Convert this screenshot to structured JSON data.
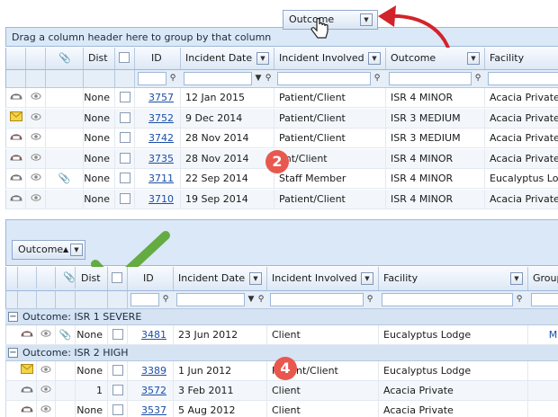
{
  "top": {
    "group_hint": "Drag a column header here to group by that column",
    "dragged_chip": "Outcome",
    "columns": [
      "Dist",
      "ID",
      "Incident Date",
      "Incident Involved",
      "Outcome",
      "Facility"
    ],
    "rows": [
      {
        "icon": "lock-grey",
        "dist": "None",
        "id": "3757",
        "date": "12 Jan 2015",
        "involved": "Patient/Client",
        "outcome": "ISR 4 MINOR",
        "facility": "Acacia Private",
        "attach": false
      },
      {
        "icon": "envelope",
        "dist": "None",
        "id": "3752",
        "date": "9 Dec 2014",
        "involved": "Patient/Client",
        "outcome": "ISR 3 MEDIUM",
        "facility": "Acacia Private",
        "attach": false
      },
      {
        "icon": "lock-red",
        "dist": "None",
        "id": "3742",
        "date": "28 Nov 2014",
        "involved": "Patient/Client",
        "outcome": "ISR 3 MEDIUM",
        "facility": "Acacia Private",
        "attach": false
      },
      {
        "icon": "lock-red",
        "dist": "None",
        "id": "3735",
        "date": "28 Nov 2014",
        "involved": "ent/Client",
        "outcome": "ISR 4 MINOR",
        "facility": "Acacia Private",
        "attach": false
      },
      {
        "icon": "lock-grey",
        "dist": "None",
        "id": "3711",
        "date": "22 Sep 2014",
        "involved": "Staff Member",
        "outcome": "ISR 4 MINOR",
        "facility": "Eucalyptus Lodge",
        "attach": true
      },
      {
        "icon": "lock-grey",
        "dist": "None",
        "id": "3710",
        "date": "19 Sep 2014",
        "involved": "Patient/Client",
        "outcome": "ISR 4 MINOR",
        "facility": "Acacia Private",
        "attach": false
      }
    ],
    "badge": "2"
  },
  "bottom": {
    "group_chip": "Outcome",
    "columns": [
      "Dist",
      "ID",
      "Incident Date",
      "Incident Involved",
      "Facility",
      "Group"
    ],
    "groups": [
      {
        "label": "Outcome: ISR 1 SEVERE",
        "rows": [
          {
            "icon": "lock-red",
            "dist": "None",
            "id": "3481",
            "date": "23 Jun 2012",
            "involved": "Client",
            "facility": "Eucalyptus Lodge",
            "group": "Ma",
            "attach": true
          }
        ]
      },
      {
        "label": "Outcome: ISR 2 HIGH",
        "rows": [
          {
            "icon": "envelope",
            "dist": "None",
            "id": "3389",
            "date": "1 Jun 2012",
            "involved": "Patient/Client",
            "facility": "Eucalyptus Lodge",
            "group": "",
            "attach": false
          },
          {
            "icon": "lock-grey",
            "dist": "1",
            "id": "3572",
            "date": "3 Feb 2011",
            "involved": "Client",
            "facility": "Acacia Private",
            "group": "",
            "attach": false
          },
          {
            "icon": "lock-red",
            "dist": "None",
            "id": "3537",
            "date": "5 Aug 2012",
            "involved": "Client",
            "facility": "Acacia Private",
            "group": "",
            "attach": false
          }
        ]
      }
    ],
    "badge": "4"
  },
  "colors": {
    "header_bg": "#dde8f5",
    "group_bar": "#dbe8f7",
    "link": "#1b4ea8",
    "badge": "#e8584f",
    "arrow": "#d3232a",
    "check": "#5aa632"
  }
}
